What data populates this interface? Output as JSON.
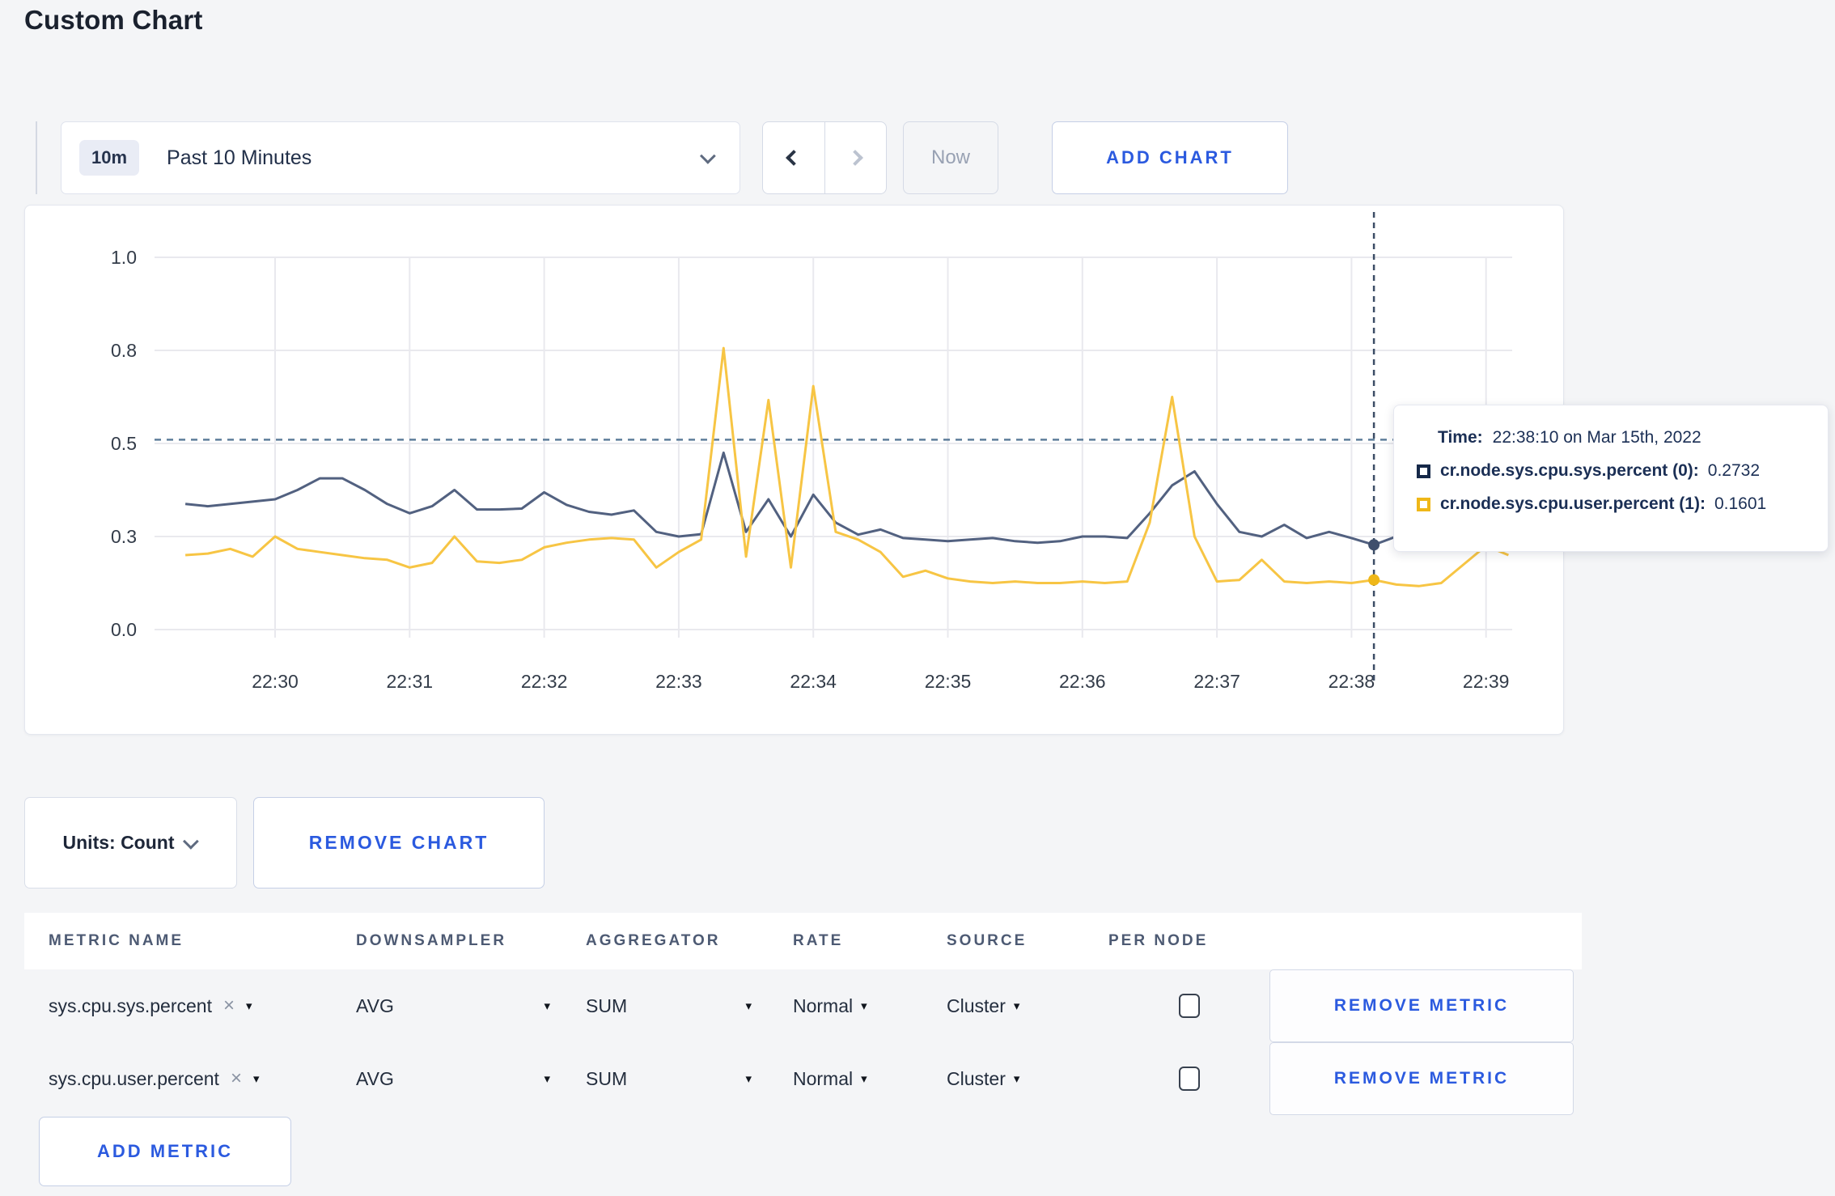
{
  "page": {
    "title": "Custom Chart",
    "background_color": "#f4f5f7",
    "accent_blue": "#2b5adf"
  },
  "toolbar": {
    "time_range": {
      "badge": "10m",
      "label": "Past 10 Minutes"
    },
    "now_label": "Now",
    "add_chart_label": "ADD CHART"
  },
  "icons": {
    "time_dropdown_chevron": "chevron-down",
    "prev": "chevron-left",
    "next": "chevron-right",
    "units_chevron": "chevron-down",
    "metric_clear": "×",
    "select_caret": "▾"
  },
  "chart_data": {
    "type": "line",
    "title": "",
    "x_axis": {
      "tick_labels": [
        "22:30",
        "22:31",
        "22:32",
        "22:33",
        "22:34",
        "22:35",
        "22:36",
        "22:37",
        "22:38",
        "22:39"
      ],
      "start_time": "22:29:20",
      "start_offset_seconds": -40,
      "step_seconds": 10
    },
    "y_axis": {
      "tick_values": [
        0,
        0.3,
        0.5,
        0.8,
        1.0
      ],
      "note": "ticks rendered evenly spaced (non-linear scale)",
      "grid": true
    },
    "series": [
      {
        "name": "cr.node.sys.cpu.sys.percent",
        "color": "#526180",
        "values": [
          0.37,
          0.365,
          0.37,
          0.375,
          0.38,
          0.4,
          0.425,
          0.425,
          0.4,
          0.37,
          0.35,
          0.365,
          0.4,
          0.358,
          0.358,
          0.36,
          0.395,
          0.368,
          0.353,
          0.347,
          0.356,
          0.31,
          0.3,
          0.305,
          0.48,
          0.31,
          0.38,
          0.3,
          0.39,
          0.33,
          0.304,
          0.315,
          0.295,
          0.29,
          0.285,
          0.29,
          0.295,
          0.285,
          0.28,
          0.285,
          0.3,
          0.3,
          0.295,
          0.35,
          0.41,
          0.44,
          0.37,
          0.31,
          0.3,
          0.325,
          0.295,
          0.31,
          0.295,
          0.2732,
          0.3,
          0.305,
          0.3,
          0.3,
          0.31,
          0.295
        ]
      },
      {
        "name": "cr.node.sys.cpu.user.percent",
        "color": "#f7c544",
        "values": [
          0.24,
          0.245,
          0.26,
          0.235,
          0.3,
          0.26,
          0.25,
          0.24,
          0.23,
          0.225,
          0.2,
          0.215,
          0.3,
          0.22,
          0.215,
          0.225,
          0.265,
          0.28,
          0.29,
          0.295,
          0.29,
          0.2,
          0.25,
          0.29,
          0.805,
          0.235,
          0.64,
          0.2,
          0.685,
          0.31,
          0.29,
          0.25,
          0.17,
          0.19,
          0.165,
          0.155,
          0.15,
          0.155,
          0.15,
          0.15,
          0.155,
          0.15,
          0.155,
          0.33,
          0.65,
          0.3,
          0.155,
          0.16,
          0.225,
          0.155,
          0.15,
          0.155,
          0.15,
          0.1601,
          0.145,
          0.14,
          0.15,
          0.21,
          0.27,
          0.24
        ]
      }
    ],
    "guideline_value": 0.512,
    "crosshair": {
      "time": "22:38:10",
      "t_seconds": 490,
      "points": [
        {
          "series": "cr.node.sys.cpu.sys.percent",
          "value": 0.2732,
          "color": "#3f4f6d"
        },
        {
          "series": "cr.node.sys.cpu.user.percent",
          "value": 0.1601,
          "color": "#efb718"
        }
      ]
    },
    "legend_position": "tooltip"
  },
  "tooltip": {
    "time_label": "Time:",
    "time_value": "22:38:10 on Mar 15th, 2022",
    "entries": [
      {
        "name": "cr.node.sys.cpu.sys.percent (0):",
        "value": "0.2732",
        "square_color": "#152848"
      },
      {
        "name": "cr.node.sys.cpu.user.percent (1):",
        "value": "0.1601",
        "square_color": "#efb718"
      }
    ]
  },
  "units_bar": {
    "units_label": "Units: Count",
    "remove_chart_label": "REMOVE CHART"
  },
  "metrics_table": {
    "headers": [
      "METRIC NAME",
      "DOWNSAMPLER",
      "AGGREGATOR",
      "RATE",
      "SOURCE",
      "PER NODE"
    ],
    "rows": [
      {
        "metric": "sys.cpu.sys.percent",
        "downsampler": "AVG",
        "aggregator": "SUM",
        "rate": "Normal",
        "source": "Cluster",
        "per_node_checked": false,
        "remove_label": "REMOVE METRIC"
      },
      {
        "metric": "sys.cpu.user.percent",
        "downsampler": "AVG",
        "aggregator": "SUM",
        "rate": "Normal",
        "source": "Cluster",
        "per_node_checked": false,
        "remove_label": "REMOVE METRIC"
      }
    ],
    "add_metric_label": "ADD METRIC"
  }
}
